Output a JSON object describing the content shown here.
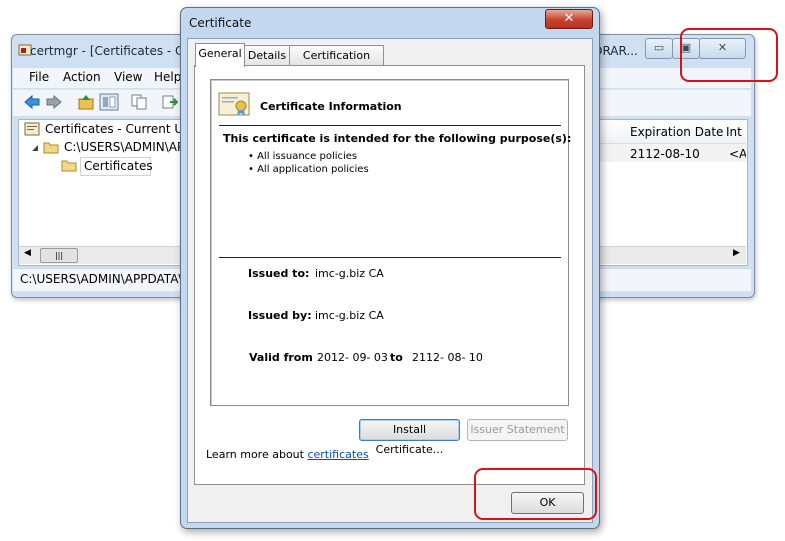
{
  "background_window": {
    "title": "certmgr - [Certificates - Cu",
    "title_tail": "ORAR...",
    "caption_buttons": {
      "minimize": "▭",
      "maximize": "▣",
      "close": "✕"
    },
    "menu": [
      "File",
      "Action",
      "View",
      "Help"
    ],
    "tree": [
      {
        "label": "Certificates - Current User",
        "icon": "certificates-icon"
      },
      {
        "label": "C:\\USERS\\ADMIN\\APPDATA",
        "icon": "folder-icon"
      },
      {
        "label": "Certificates",
        "icon": "folder-icon"
      }
    ],
    "columns": [
      "Expiration Date",
      "Int"
    ],
    "row": {
      "expiration": "2112-08-10",
      "intended": "<A"
    },
    "scroll_thumb": "|||",
    "status_text": "C:\\USERS\\ADMIN\\APPDATA\\L"
  },
  "dialog": {
    "title": "Certificate",
    "close_glyph": "✕",
    "tabs": [
      "General",
      "Details",
      "Certification Path"
    ],
    "active_tab": "General",
    "info_heading": "Certificate Information",
    "purpose_heading": "This certificate is intended for the following purpose(s):",
    "purposes": [
      "All issuance policies",
      "All application policies"
    ],
    "issued_to_label": "Issued to:",
    "issued_to": "imc-g.biz CA",
    "issued_by_label": "Issued by:",
    "issued_by": "imc-g.biz CA",
    "valid_from_label": "Valid from",
    "valid_from": "2012- 09- 03",
    "valid_to_label": "to",
    "valid_to": "2112- 08- 10",
    "install_button": "Install Certificate...",
    "issuer_button": "Issuer Statement",
    "learn_more_prefix": "Learn more about",
    "learn_more_link": "certificates",
    "ok_button": "OK"
  },
  "colors": {
    "annotation": "#d4131b",
    "link": "#0b4ea2",
    "titlebar": "#c3d8ef"
  }
}
